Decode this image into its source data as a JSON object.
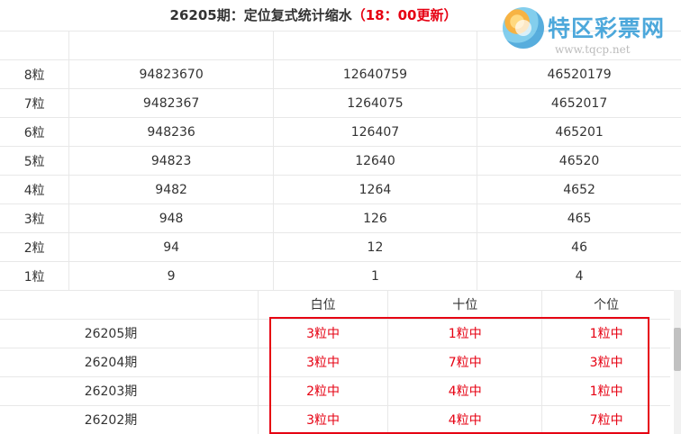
{
  "header": {
    "title": "26205期：定位复式统计缩水",
    "update_time": "（18：00更新）"
  },
  "logo": {
    "name": "特区彩票网",
    "url": "www.tqcp.net"
  },
  "grain_table": {
    "rows": [
      {
        "label": "8粒",
        "values": [
          "94823670",
          "12640759",
          "46520179"
        ]
      },
      {
        "label": "7粒",
        "values": [
          "9482367",
          "1264075",
          "4652017"
        ]
      },
      {
        "label": "6粒",
        "values": [
          "948236",
          "126407",
          "465201"
        ]
      },
      {
        "label": "5粒",
        "values": [
          "94823",
          "12640",
          "46520"
        ]
      },
      {
        "label": "4粒",
        "values": [
          "9482",
          "1264",
          "4652"
        ]
      },
      {
        "label": "3粒",
        "values": [
          "948",
          "126",
          "465"
        ]
      },
      {
        "label": "2粒",
        "values": [
          "94",
          "12",
          "46"
        ]
      },
      {
        "label": "1粒",
        "values": [
          "9",
          "1",
          "4"
        ]
      }
    ]
  },
  "result_table": {
    "headers": [
      "白位",
      "十位",
      "个位"
    ],
    "rows": [
      {
        "period": "26205期",
        "values": [
          "3粒中",
          "1粒中",
          "1粒中"
        ]
      },
      {
        "period": "26204期",
        "values": [
          "3粒中",
          "7粒中",
          "3粒中"
        ]
      },
      {
        "period": "26203期",
        "values": [
          "2粒中",
          "4粒中",
          "1粒中"
        ]
      },
      {
        "period": "26202期",
        "values": [
          "3粒中",
          "4粒中",
          "7粒中"
        ]
      }
    ]
  },
  "colors": {
    "accent_red": "#e60012",
    "logo_blue": "#3a9fd8"
  }
}
